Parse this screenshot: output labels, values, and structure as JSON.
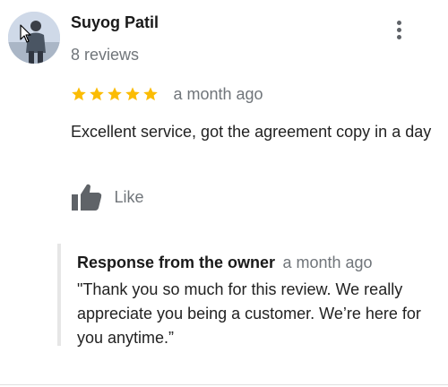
{
  "review": {
    "reviewer_name": "Suyog Patil",
    "review_count": "8 reviews",
    "rating": 5,
    "rating_max": 5,
    "date": "a month ago",
    "text": "Excellent service, got the agreement copy in a day",
    "like_label": "Like"
  },
  "owner_response": {
    "title": "Response from the owner",
    "date": "a month ago",
    "text": "\"Thank you so much for this review. We really appreciate you being a customer. We’re here for you anytime.”"
  },
  "icons": {
    "more": "more-vert-icon",
    "star": "star-icon",
    "like": "thumb-up-icon"
  },
  "colors": {
    "star": "#fbbc04",
    "secondary_text": "#70757a",
    "icon_gray": "#5f6368"
  }
}
